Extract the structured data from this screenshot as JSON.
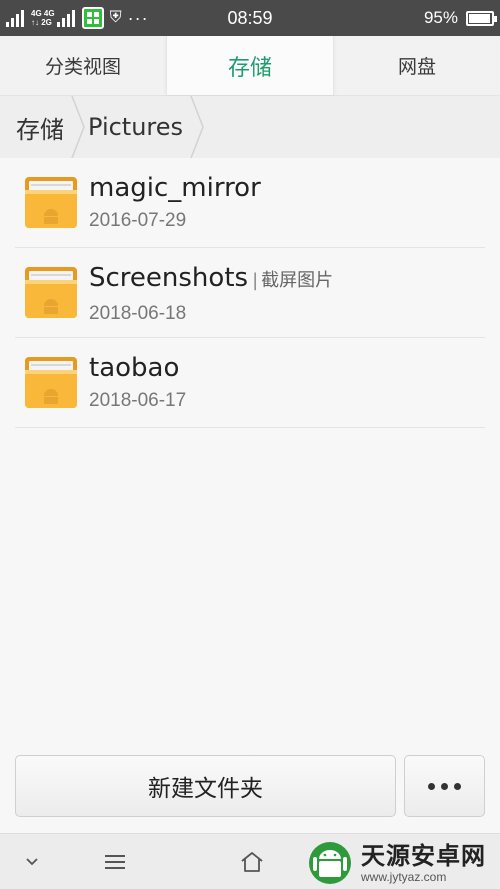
{
  "status_bar": {
    "time": "08:59",
    "battery": "95%",
    "battery_level": 0.95,
    "sim1_label": "2G",
    "net_top": "4G 4G",
    "net_bottom": "↑↓ 2G",
    "more": "···"
  },
  "tabs": [
    {
      "label": "分类视图",
      "active": false
    },
    {
      "label": "存储",
      "active": true
    },
    {
      "label": "网盘",
      "active": false
    }
  ],
  "breadcrumb": [
    "存储",
    "Pictures"
  ],
  "files": [
    {
      "name": "magic_mirror",
      "tag": "",
      "date": "2016-07-29"
    },
    {
      "name": "Screenshots",
      "tag": "截屏图片",
      "date": "2018-06-18"
    },
    {
      "name": "taobao",
      "tag": "",
      "date": "2018-06-17"
    }
  ],
  "actions": {
    "new_folder_label": "新建文件夹"
  },
  "watermark": {
    "title": "天源安卓网",
    "url": "www.jytyaz.com"
  },
  "colors": {
    "accent": "#1e9c6f",
    "folder": "#f7b234",
    "status_bar": "#4a4a4a"
  }
}
